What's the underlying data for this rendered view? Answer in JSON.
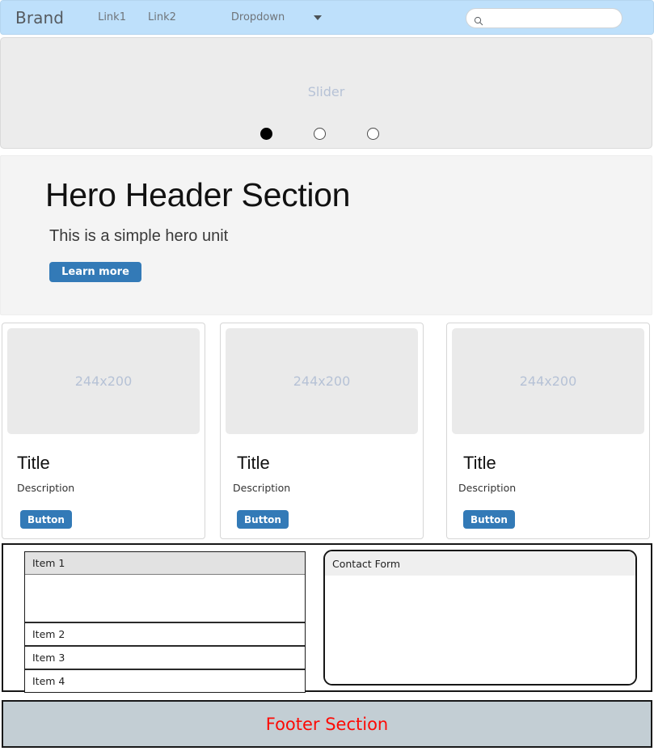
{
  "navbar": {
    "brand": "Brand",
    "links": [
      {
        "label": "Link1"
      },
      {
        "label": "Link2"
      }
    ],
    "dropdown": {
      "label": "Dropdown",
      "caret_icon": "chevron-down-icon"
    },
    "search": {
      "icon": "search-icon",
      "value": "",
      "placeholder": ""
    },
    "background_color": "#bee0fb"
  },
  "slider": {
    "label": "Slider",
    "background_color": "#ececec",
    "label_color": "#b6c2d6",
    "dots": [
      {
        "index": 1,
        "active": true
      },
      {
        "index": 2,
        "active": false
      },
      {
        "index": 3,
        "active": false
      }
    ]
  },
  "hero": {
    "title": "Hero Header Section",
    "subtitle": "This is a simple hero unit",
    "button_label": "Learn more",
    "background_color": "#f4f4f4",
    "button_color": "#337ab7"
  },
  "cards": [
    {
      "image_placeholder": "244x200",
      "title": "Title",
      "description": "Description",
      "button_label": "Button"
    },
    {
      "image_placeholder": "244x200",
      "title": "Title",
      "description": "Description",
      "button_label": "Button"
    },
    {
      "image_placeholder": "244x200",
      "title": "Title",
      "description": "Description",
      "button_label": "Button"
    }
  ],
  "list_group": {
    "items": [
      {
        "label": "Item 1",
        "active": true
      },
      {
        "label": "Item 2",
        "active": false
      },
      {
        "label": "Item 3",
        "active": false
      },
      {
        "label": "Item 4",
        "active": false
      }
    ]
  },
  "contact_form": {
    "header": "Contact Form"
  },
  "footer": {
    "text": "Footer Section",
    "background_color": "#c3ced4",
    "text_color": "#fc0b06"
  }
}
